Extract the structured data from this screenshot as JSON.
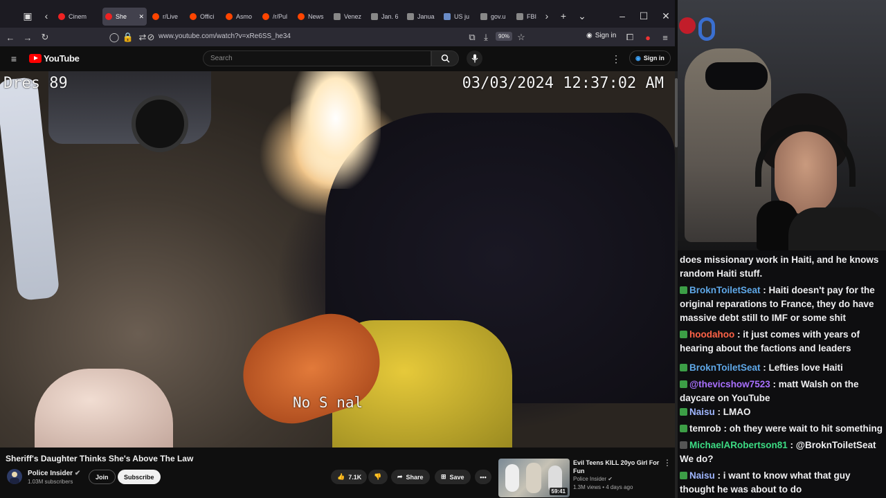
{
  "browser": {
    "tabs": [
      {
        "label": "Cinem",
        "icon": "youtube-icon"
      },
      {
        "label": "She",
        "icon": "youtube-icon",
        "active": true
      },
      {
        "label": "r/Live",
        "icon": "reddit-icon"
      },
      {
        "label": "Offici",
        "icon": "reddit-icon"
      },
      {
        "label": "Asmo",
        "icon": "reddit-icon"
      },
      {
        "label": "/r/Pul",
        "icon": "reddit-icon"
      },
      {
        "label": "News",
        "icon": "reddit-icon"
      },
      {
        "label": "Venez",
        "icon": "site-icon"
      },
      {
        "label": "Jan. 6",
        "icon": "site-icon"
      },
      {
        "label": "Janua",
        "icon": "site-icon"
      },
      {
        "label": "US ju",
        "icon": "google-icon"
      },
      {
        "label": "gov.u",
        "icon": "site-icon"
      },
      {
        "label": "FBI a",
        "icon": "site-icon"
      }
    ],
    "url": "www.youtube.com/watch?v=xRe6SS_he34",
    "zoom": "90%",
    "signin_label": "Sign in"
  },
  "youtube": {
    "logo_text": "YouTube",
    "search_placeholder": "Search",
    "signin_label": "Sign in"
  },
  "video": {
    "osd_id": "Dres  89",
    "osd_timestamp": "03/03/2024  12:37:02 AM",
    "osd_signal": "No S  nal",
    "title": "Sheriff's Daughter Thinks She's Above The Law",
    "channel": "Police Insider",
    "subscribers": "1.03M subscribers",
    "join_label": "Join",
    "subscribe_label": "Subscribe",
    "likes": "7.1K",
    "share_label": "Share",
    "save_label": "Save"
  },
  "recommended": {
    "title": "Evil Teens KILL 20yo Girl For Fun",
    "channel": "Police Insider",
    "meta": "1.3M views • 4 days ago",
    "duration": "59:41"
  },
  "chat": {
    "messages": [
      {
        "user": "",
        "text": "does missionary work in Haiti, and he knows random Haiti stuff.",
        "color": "#efeff1"
      },
      {
        "user": "BroknToiletSeat",
        "text": "Haiti doesn't pay for the original reparations to France, they do have massive debt still to IMF or some shit",
        "color": "#5fa8e8"
      },
      {
        "user": "hoodahoo",
        "text": "it just comes with years of hearing about the factions and leaders",
        "color": "#ff6347"
      },
      {
        "user": "BroknToiletSeat",
        "text": "Lefties love Haiti",
        "color": "#5fa8e8"
      },
      {
        "user": "@thevicshow7523",
        "text": "matt Walsh on the daycare on YouTube",
        "color": "#a970ff"
      },
      {
        "user": "Naisu",
        "text": "LMAO",
        "color": "#9fb6ff"
      },
      {
        "user": "temrob",
        "text": "oh they were wait to hit something",
        "color": "#efeff1"
      },
      {
        "user": "MichaelARobertson81",
        "text": "@BroknToiletSeat We do?",
        "color": "#3ddc84"
      },
      {
        "user": "Naisu",
        "text": "i want to know what that guy thought he was about to do",
        "color": "#9fb6ff"
      }
    ]
  }
}
